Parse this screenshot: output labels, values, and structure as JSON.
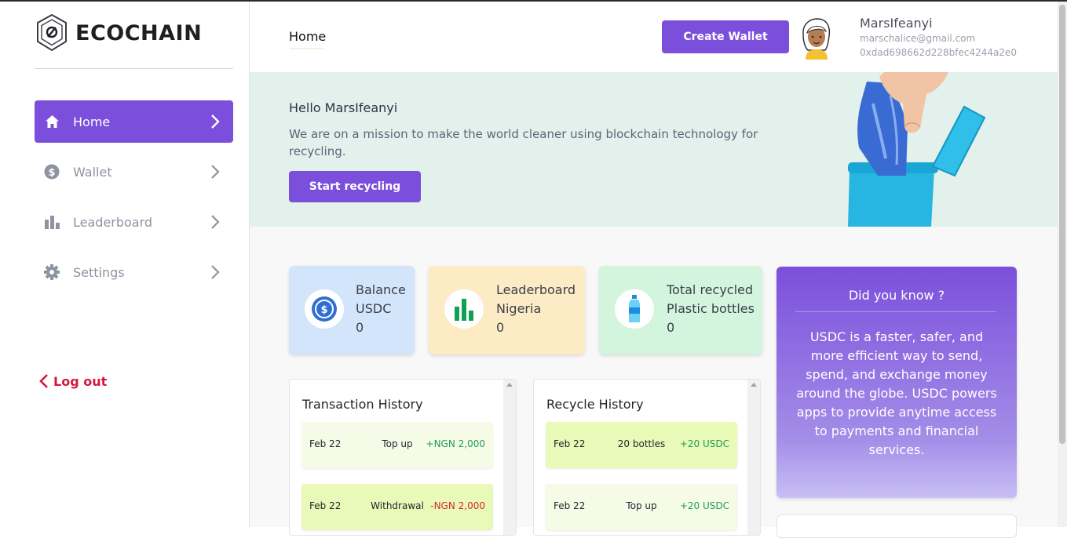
{
  "brand": {
    "name": "ECOCHAIN"
  },
  "sidebar": {
    "items": [
      {
        "label": "Home",
        "icon": "home-icon",
        "active": true
      },
      {
        "label": "Wallet",
        "icon": "dollar-coin-icon",
        "active": false
      },
      {
        "label": "Leaderboard",
        "icon": "bar-chart-icon",
        "active": false
      },
      {
        "label": "Settings",
        "icon": "gear-icon",
        "active": false
      }
    ],
    "logout_label": "Log out"
  },
  "header": {
    "title": "Home",
    "create_wallet_label": "Create Wallet",
    "user": {
      "name": "MarsIfeanyi",
      "email": "marschalice@gmail.com",
      "wallet": "0xdad698662d228bfec4244a2e0"
    }
  },
  "hero": {
    "greeting": "Hello MarsIfeanyi",
    "text": "We are on a mission to make the world cleaner using blockchain technology for recycling.",
    "button_label": "Start recycling"
  },
  "stats": [
    {
      "line1": "Balance",
      "line2": "USDC",
      "value": "0",
      "icon": "usdc-coin-icon"
    },
    {
      "line1": "Leaderboard",
      "line2": "Nigeria",
      "value": "0",
      "icon": "green-bar-chart-icon"
    },
    {
      "line1": "Total recycled",
      "line2": "Plastic bottles",
      "value": "0",
      "icon": "water-bottle-icon"
    }
  ],
  "info": {
    "title": "Did you know ?",
    "text": "USDC is a faster, safer, and more efficient way to send, spend, and exchange money around the globe. USDC powers apps to provide anytime access to payments and financial services."
  },
  "transactions": {
    "title": "Transaction History",
    "rows": [
      {
        "date": "Feb 22",
        "desc": "Top up",
        "amount": "+NGN 2,000"
      },
      {
        "date": "Feb 22",
        "desc": "Withdrawal",
        "amount": "-NGN 2,000"
      }
    ]
  },
  "recycles": {
    "title": "Recycle History",
    "rows": [
      {
        "date": "Feb 22",
        "desc": "20 bottles",
        "amount": "+20 USDC"
      },
      {
        "date": "Feb 22",
        "desc": "Top up",
        "amount": "+20 USDC"
      }
    ]
  },
  "colors": {
    "accent": "#7b4fdb",
    "logout": "#d6173d",
    "positive": "#1e9b5a",
    "negative": "#d12b2b"
  }
}
